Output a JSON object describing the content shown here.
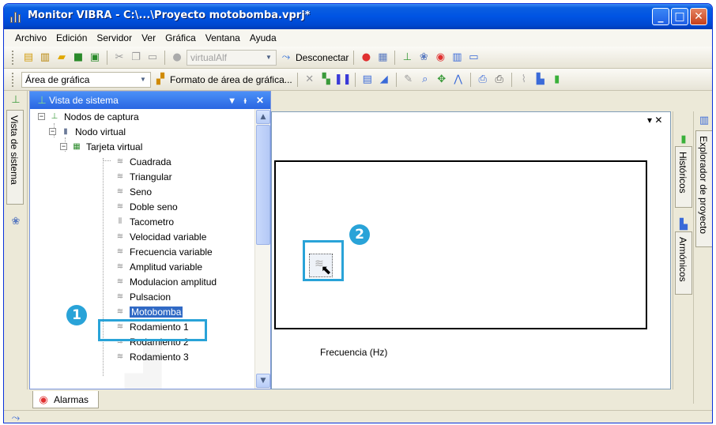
{
  "window": {
    "title": "Monitor VIBRA - C:\\...\\Proyecto motobomba.vprj*",
    "buttons": {
      "minimize": "_",
      "maximize": "□",
      "close": "✕"
    }
  },
  "menu": [
    "Archivo",
    "Edición",
    "Servidor",
    "Ver",
    "Gráfica",
    "Ventana",
    "Ayuda"
  ],
  "toolbar1": {
    "server_combo": "virtualAlf",
    "disconnect_label": "Desconectar"
  },
  "toolbar2": {
    "area_combo": "Área de gráfica",
    "format_label": "Formato de área de gráfica..."
  },
  "left_tabs": {
    "system_view": "Vista de sistema"
  },
  "system_panel": {
    "title": "Vista de sistema",
    "controls": {
      "dropdown": "▾",
      "pin": "ᵻ",
      "close": "✕"
    },
    "tree": {
      "root": "Nodos de captura",
      "virtual_node": "Nodo virtual",
      "card": "Tarjeta virtual",
      "signals": [
        "Cuadrada",
        "Triangular",
        "Seno",
        "Doble seno",
        "Tacometro",
        "Velocidad variable",
        "Frecuencia variable",
        "Amplitud variable",
        "Modulacion amplitud",
        "Pulsacion",
        "Motobomba",
        "Rodamiento 1",
        "Rodamiento 2",
        "Rodamiento 3"
      ],
      "selected": "Motobomba"
    }
  },
  "bottom_tabs": {
    "alarms": "Alarmas"
  },
  "chart_area": {
    "close_controls": "▾ ✕",
    "xlabel": "Frecuencia (Hz)"
  },
  "right_tabs": {
    "historicos": "Históricos",
    "armonicos": "Armónicos",
    "explorer": "Explorador de proyecto"
  },
  "callouts": {
    "one": "1",
    "two": "2"
  },
  "colors": {
    "accent": "#29a3d8",
    "selection": "#316ac5",
    "titlebar": "#0054e3"
  }
}
